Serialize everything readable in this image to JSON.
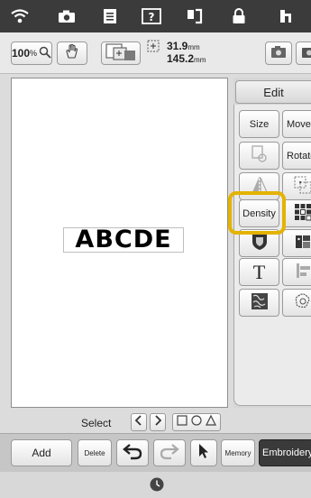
{
  "status_bar": {
    "icons": [
      "wifi-icon",
      "camera-icon",
      "document-icon",
      "help-icon",
      "thread-icon",
      "lock-icon",
      "needle-icon"
    ]
  },
  "info_bar": {
    "zoom_value": "100",
    "zoom_unit": "%",
    "width_value": "31.9",
    "height_value": "145.2",
    "unit": "mm"
  },
  "canvas": {
    "pattern_text": "ABCDE"
  },
  "edit_panel": {
    "tab_label": "Edit",
    "buttons": {
      "size": "Size",
      "move": "Move",
      "rotate": "Rotate",
      "density": "Density",
      "text_tool": "T"
    }
  },
  "select_bar": {
    "label": "Select"
  },
  "bottom_bar": {
    "add": "Add",
    "delete": "Delete",
    "memory": "Memory",
    "embroidery": "Embroidery"
  },
  "colors": {
    "highlight": "#e3b300",
    "topbar": "#3b3b3b",
    "embroidery_button": "#3a3a3a"
  }
}
